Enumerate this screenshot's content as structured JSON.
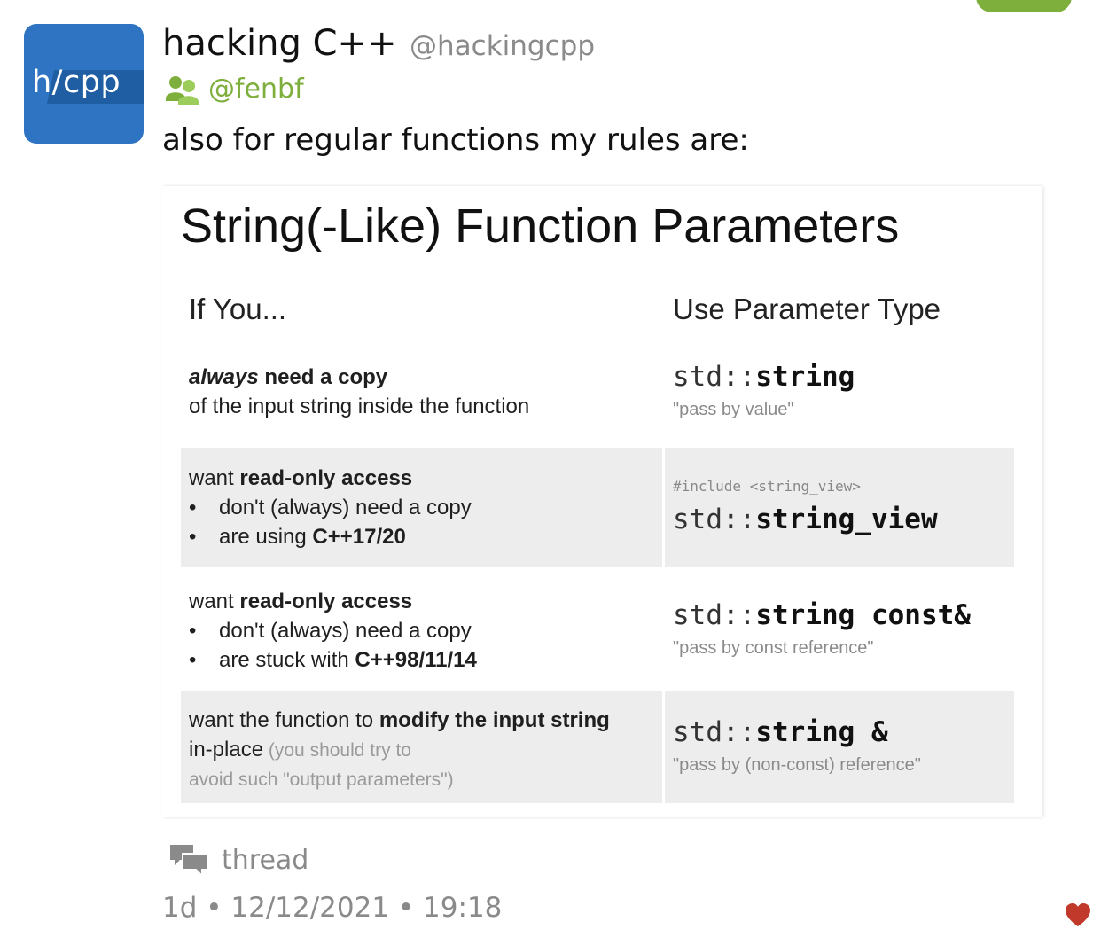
{
  "post": {
    "author_name": "hacking C++",
    "author_handle": "@hackingcpp",
    "avatar_text": "h/cpp",
    "booster_handle": "@fenbf",
    "text": "also for regular functions my rules are:"
  },
  "attachment": {
    "title": "String(-Like) Function Parameters",
    "col_left_header": "If You...",
    "col_right_header": "Use Parameter Type",
    "rows": [
      {
        "l1_i": "always",
        "l1_b": " need a copy",
        "l2": "of the input string inside the function",
        "code_plain": "std::",
        "code_bold": "string",
        "note": "\"pass by value\""
      },
      {
        "l1_plain": "want ",
        "l1_b": "read-only access",
        "b1": "don't (always) need a copy",
        "b2_plain": "are using ",
        "b2_b": "C++17/20",
        "include": "#include <string_view>",
        "code_plain": "std::",
        "code_bold": "string_view"
      },
      {
        "l1_plain": "want ",
        "l1_b": "read-only access",
        "b1": "don't (always) need a copy",
        "b2_plain": "are stuck with ",
        "b2_b": "C++98/11/14",
        "code_plain": "std::",
        "code_bold": "string const&",
        "note": "\"pass by const reference\""
      },
      {
        "l1_plain": "want the function to ",
        "l1_b": "modify the input string",
        "l2_plain": "in-place",
        "l2_muted": " (you should try to",
        "l3_muted": "avoid such \"output parameters\")",
        "code_plain": "std::",
        "code_bold": "string &",
        "note": "\"pass by (non-const) reference\""
      }
    ]
  },
  "footer": {
    "thread_label": "thread",
    "meta": "1d • 12/12/2021 • 19:18"
  },
  "icons": {
    "booster": "users-icon",
    "thread": "chat-bubbles-icon",
    "favorite": "heart-icon"
  },
  "colors": {
    "accent": "#7eaf3c",
    "avatar_bg": "#2f74c2",
    "heart": "#c0392b"
  }
}
